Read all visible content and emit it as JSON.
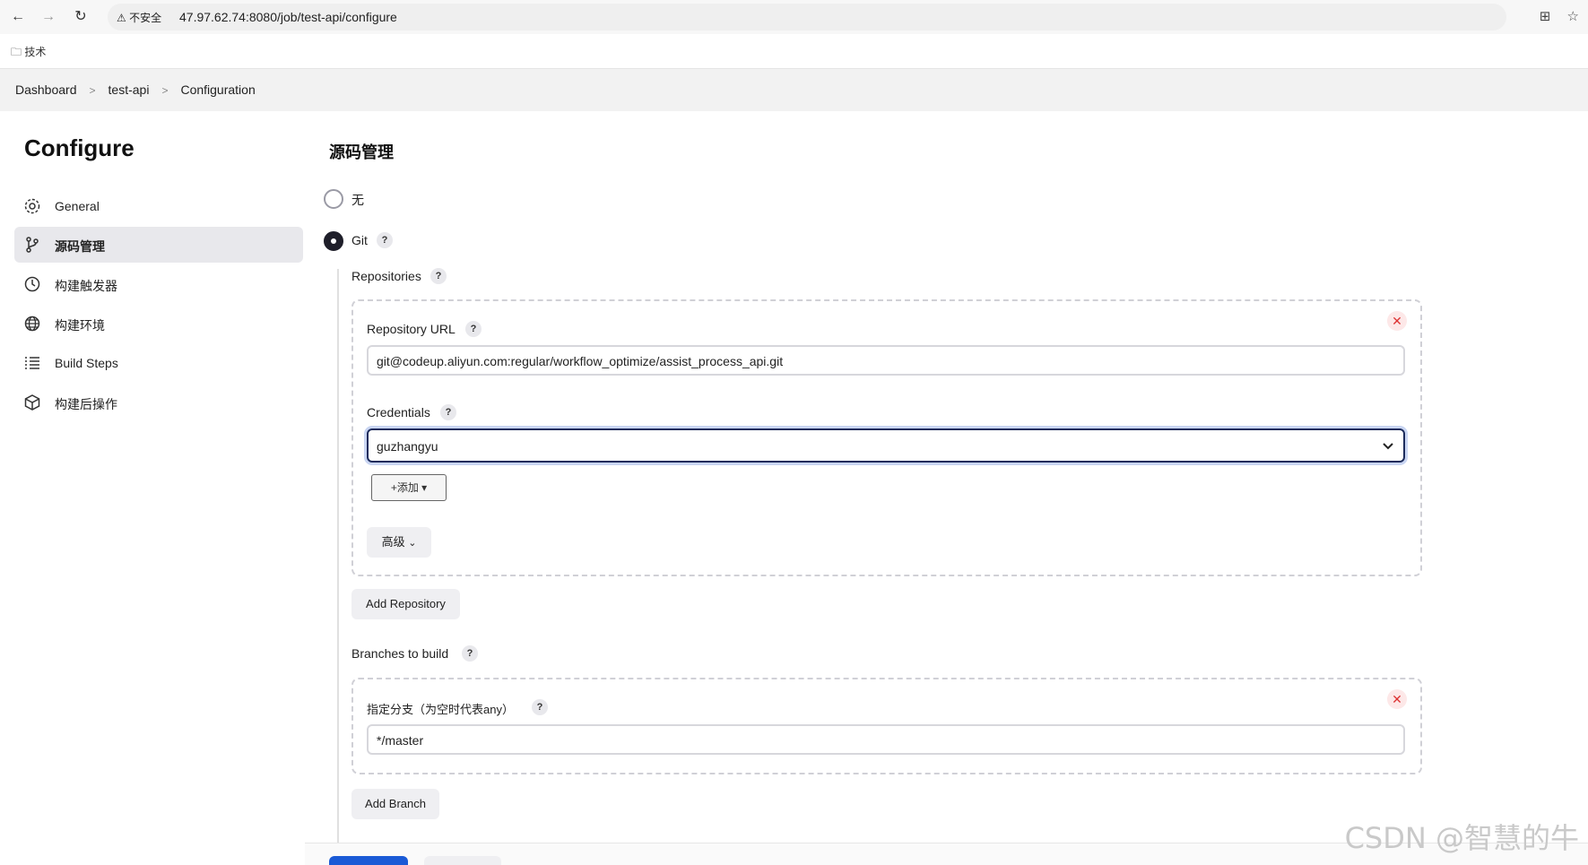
{
  "browser": {
    "insecure_label": "不安全",
    "url": "47.97.62.74:8080/job/test-api/configure",
    "bookmark": "技术"
  },
  "breadcrumb": [
    "Dashboard",
    "test-api",
    "Configuration"
  ],
  "sidebar": {
    "title": "Configure",
    "items": [
      {
        "label": "General",
        "icon": "gear-icon"
      },
      {
        "label": "源码管理",
        "icon": "branch-icon",
        "active": true
      },
      {
        "label": "构建触发器",
        "icon": "clock-icon"
      },
      {
        "label": "构建环境",
        "icon": "globe-icon"
      },
      {
        "label": "Build Steps",
        "icon": "list-icon"
      },
      {
        "label": "构建后操作",
        "icon": "box-icon"
      }
    ]
  },
  "scm": {
    "title": "源码管理",
    "option_none": "无",
    "option_git": "Git",
    "selected": "Git",
    "repositories_label": "Repositories",
    "repo_url_label": "Repository URL",
    "repo_url_value": "git@codeup.aliyun.com:regular/workflow_optimize/assist_process_api.git",
    "credentials_label": "Credentials",
    "credentials_value": "guzhangyu",
    "add_button": "+添加 ▾",
    "advanced_button": "高级",
    "add_repository": "Add Repository",
    "branches_label": "Branches to build",
    "branch_spec_label": "指定分支（为空时代表any）",
    "branch_spec_value": "*/master",
    "add_branch": "Add Branch",
    "help_mark": "?"
  },
  "watermark": "CSDN @智慧的牛",
  "colors": {
    "accent": "#1a5ad6",
    "focus_border": "#1d2c5c",
    "remove": "#dd3333"
  }
}
